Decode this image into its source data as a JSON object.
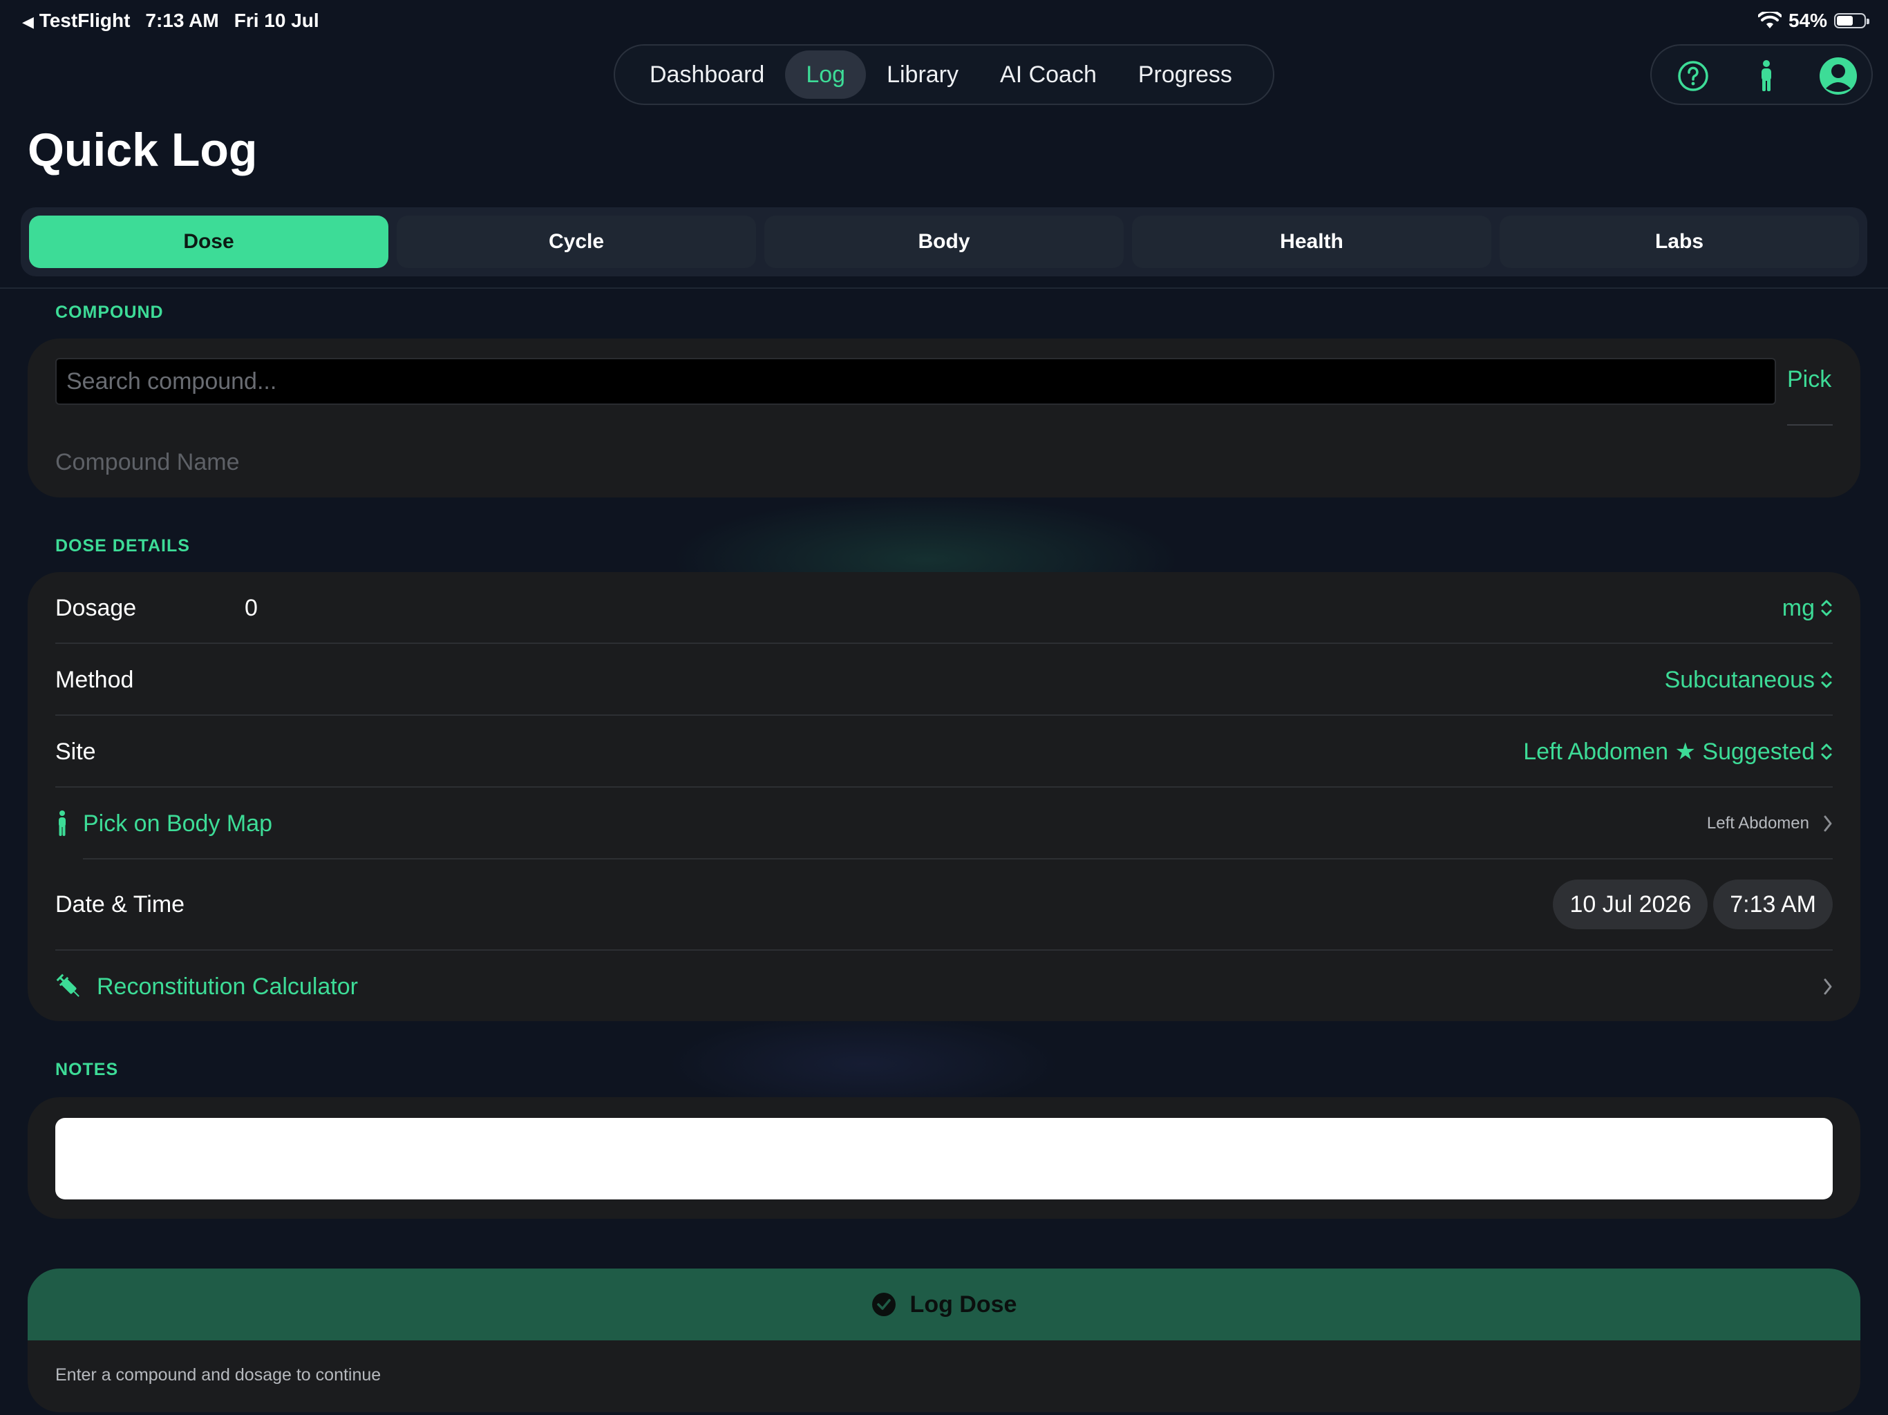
{
  "status_bar": {
    "back_app": "TestFlight",
    "time": "7:13 AM",
    "date": "Fri 10 Jul",
    "battery": "54%"
  },
  "nav": {
    "items": [
      {
        "label": "Dashboard",
        "active": false
      },
      {
        "label": "Log",
        "active": true
      },
      {
        "label": "Library",
        "active": false
      },
      {
        "label": "AI Coach",
        "active": false
      },
      {
        "label": "Progress",
        "active": false
      }
    ]
  },
  "header_icons": [
    "help-circle-icon",
    "person-figure-icon",
    "profile-avatar-icon"
  ],
  "page": {
    "title": "Quick Log"
  },
  "segments": [
    "Dose",
    "Cycle",
    "Body",
    "Health",
    "Labs"
  ],
  "compound": {
    "section_label": "COMPOUND",
    "search_placeholder": "Search compound...",
    "pick_label": "Pick",
    "name_placeholder": "Compound Name"
  },
  "dose_details": {
    "section_label": "DOSE DETAILS",
    "dosage_label": "Dosage",
    "dosage_value": "0",
    "dosage_unit": "mg",
    "method_label": "Method",
    "method_value": "Subcutaneous",
    "site_label": "Site",
    "site_value": "Left Abdomen ★ Suggested",
    "body_map_label": "Pick on Body Map",
    "body_map_value": "Left Abdomen",
    "datetime_label": "Date & Time",
    "date_value": "10 Jul 2026",
    "time_value": "7:13 AM",
    "calculator_label": "Reconstitution Calculator"
  },
  "notes": {
    "section_label": "NOTES",
    "value": ""
  },
  "log": {
    "button_label": "Log Dose",
    "hint": "Enter a compound and dosage to continue"
  },
  "colors": {
    "accent": "#3ddc97",
    "background": "#0e1420",
    "card": "#1b1c1e",
    "log_button": "#1f5c47"
  }
}
